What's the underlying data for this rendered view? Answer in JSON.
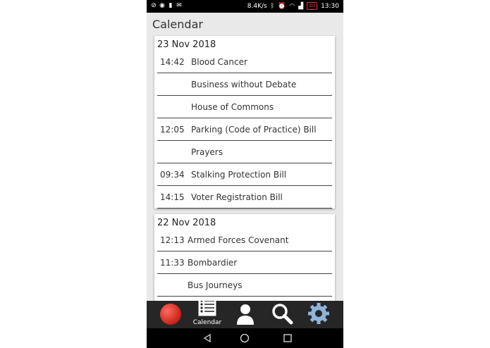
{
  "status_bar": {
    "speed": "8.4K/s",
    "battery": "20",
    "time": "13:30"
  },
  "header": {
    "title": "Calendar"
  },
  "days": [
    {
      "date": "23 Nov 2018",
      "items": [
        {
          "time": "14:42",
          "name": "Blood Cancer"
        },
        {
          "time": "",
          "name": "Business without Debate"
        },
        {
          "time": "",
          "name": "House of Commons"
        },
        {
          "time": "12:05",
          "name": "Parking (Code of Practice) Bill"
        },
        {
          "time": "",
          "name": "Prayers"
        },
        {
          "time": "09:34",
          "name": "Stalking Protection Bill"
        },
        {
          "time": "14:15",
          "name": "Voter Registration Bill"
        }
      ]
    },
    {
      "date": "22 Nov 2018",
      "items": [
        {
          "time": "12:13",
          "name": "Armed Forces Covenant"
        },
        {
          "time": "11:33",
          "name": "Bombardier"
        },
        {
          "time": "",
          "name": "Bus Journeys"
        }
      ]
    }
  ],
  "bottom_nav": {
    "items": [
      {
        "icon": "red-circle-icon",
        "label": ""
      },
      {
        "icon": "calendar-list-icon",
        "label": "Calendar"
      },
      {
        "icon": "person-icon",
        "label": ""
      },
      {
        "icon": "search-icon",
        "label": ""
      },
      {
        "icon": "gear-icon",
        "label": ""
      }
    ]
  },
  "colors": {
    "nav_background": "#262626",
    "status_bar": "#000000",
    "page_background": "#e9e9e9",
    "accent_red": "#e53935",
    "gear_blue": "#8fb4d9"
  }
}
